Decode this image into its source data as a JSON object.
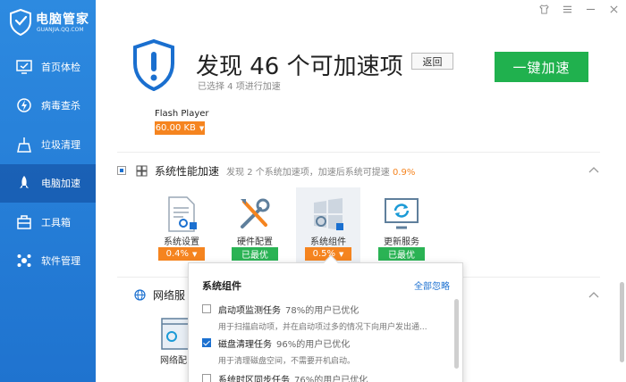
{
  "app": {
    "brand": "电脑管家",
    "domain": "GUANJIA.QQ.COM"
  },
  "sidebar": {
    "items": [
      {
        "label": "首页体检",
        "icon": "monitor-check-icon"
      },
      {
        "label": "病毒查杀",
        "icon": "lightning-shield-icon"
      },
      {
        "label": "垃圾清理",
        "icon": "broom-icon"
      },
      {
        "label": "电脑加速",
        "icon": "rocket-icon",
        "active": true
      },
      {
        "label": "工具箱",
        "icon": "toolbox-icon"
      },
      {
        "label": "软件管理",
        "icon": "software-manager-icon"
      }
    ]
  },
  "header": {
    "title": "发现 46 个可加速项",
    "back_label": "返回",
    "subtitle": "已选择 4 项进行加速",
    "cta_label": "一键加速"
  },
  "flash": {
    "name": "Flash Player",
    "size": "60.00 KB"
  },
  "system_section": {
    "title": "系统性能加速",
    "desc_prefix": "发现 2 个系统加速项，加速后系统可提速",
    "desc_pct": "0.9%",
    "tiles": [
      {
        "label": "系统设置",
        "badge": "0.4%",
        "badge_type": "orange",
        "icon": "system-settings-icon"
      },
      {
        "label": "硬件配置",
        "badge": "已最优",
        "badge_type": "green",
        "icon": "hardware-tools-icon"
      },
      {
        "label": "系统组件",
        "badge": "0.5%",
        "badge_type": "orange",
        "icon": "windows-component-icon"
      },
      {
        "label": "更新服务",
        "badge": "已最优",
        "badge_type": "green",
        "icon": "update-service-icon"
      }
    ]
  },
  "network_section": {
    "title": "网络服",
    "tile_label": "网络配"
  },
  "popover": {
    "title": "系统组件",
    "ignore_all": "全部忽略",
    "items": [
      {
        "name": "启动项监测任务",
        "stat": "78%的用户已优化",
        "detail": "用于扫描启动项，并在启动项过多的情况下向用户发出通...",
        "checked": false
      },
      {
        "name": "磁盘清理任务",
        "stat": "96%的用户已优化",
        "detail": "用于清理磁盘空间，不需要开机启动。",
        "checked": true
      },
      {
        "name": "系统时区同步任务",
        "stat": "76%的用户已优化",
        "detail": "",
        "checked": false
      }
    ]
  }
}
